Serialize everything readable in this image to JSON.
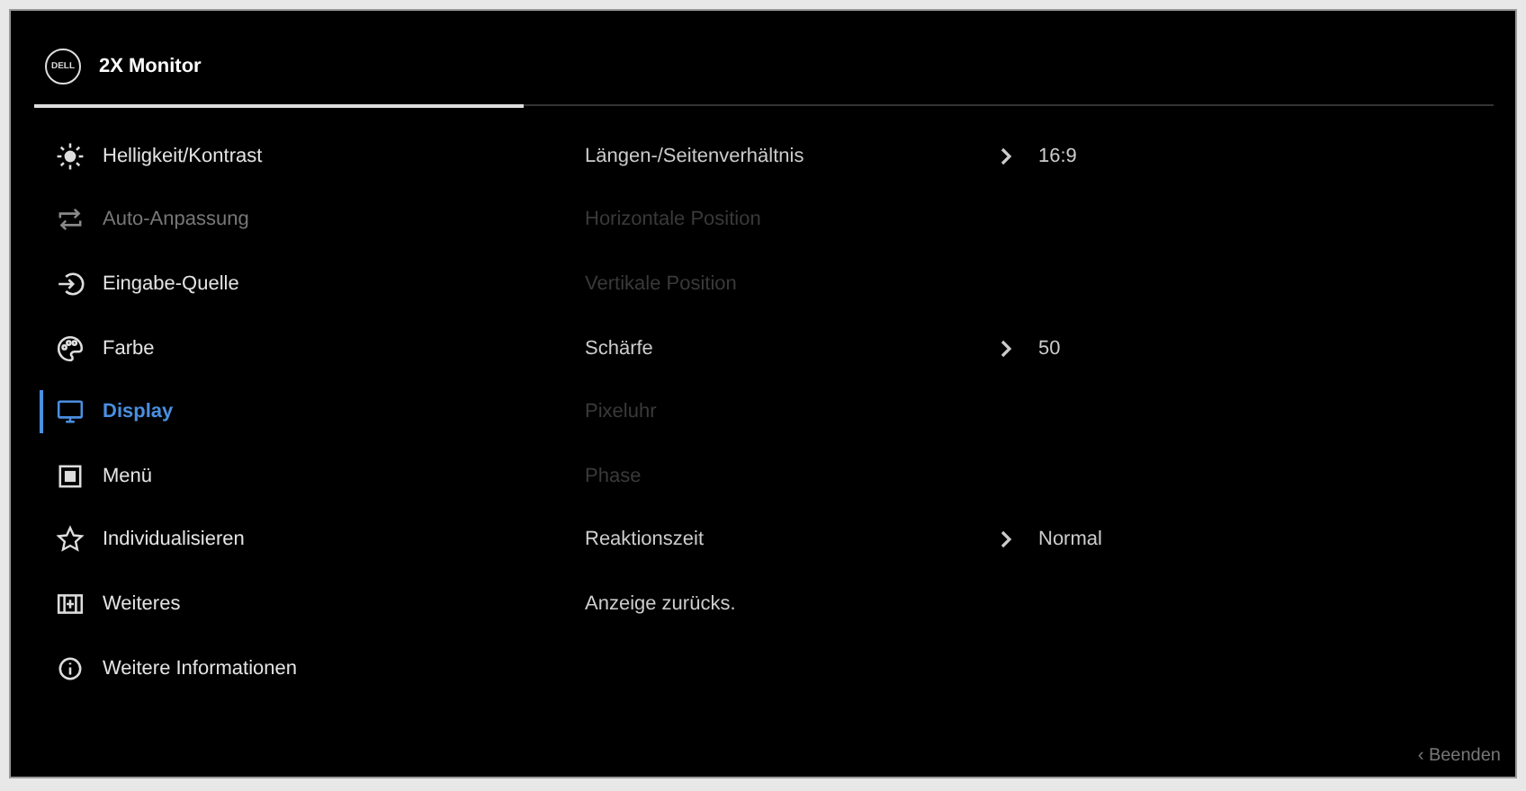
{
  "header": {
    "logo": "DELL",
    "title": "2X Monitor"
  },
  "menu": [
    {
      "label": "Helligkeit/Kontrast",
      "selected": false,
      "disabled": false
    },
    {
      "label": "Auto-Anpassung",
      "selected": false,
      "disabled": true
    },
    {
      "label": "Eingabe-Quelle",
      "selected": false,
      "disabled": false
    },
    {
      "label": "Farbe",
      "selected": false,
      "disabled": false
    },
    {
      "label": "Display",
      "selected": true,
      "disabled": false
    },
    {
      "label": "Menü",
      "selected": false,
      "disabled": false
    },
    {
      "label": "Individualisieren",
      "selected": false,
      "disabled": false
    },
    {
      "label": "Weiteres",
      "selected": false,
      "disabled": false
    },
    {
      "label": "Weitere Informationen",
      "selected": false,
      "disabled": false
    }
  ],
  "submenu": [
    {
      "label": "Längen-/Seitenverhältnis",
      "disabled": false,
      "value": "16:9"
    },
    {
      "label": "Horizontale Position",
      "disabled": true
    },
    {
      "label": "Vertikale Position",
      "disabled": true
    },
    {
      "label": "Schärfe",
      "disabled": false,
      "value": "50"
    },
    {
      "label": "Pixeluhr",
      "disabled": true
    },
    {
      "label": "Phase",
      "disabled": true
    },
    {
      "label": "Reaktionszeit",
      "disabled": false,
      "value": "Normal"
    },
    {
      "label": "Anzeige zurücks.",
      "disabled": false
    }
  ],
  "footer": {
    "exit": "‹ Beenden"
  }
}
